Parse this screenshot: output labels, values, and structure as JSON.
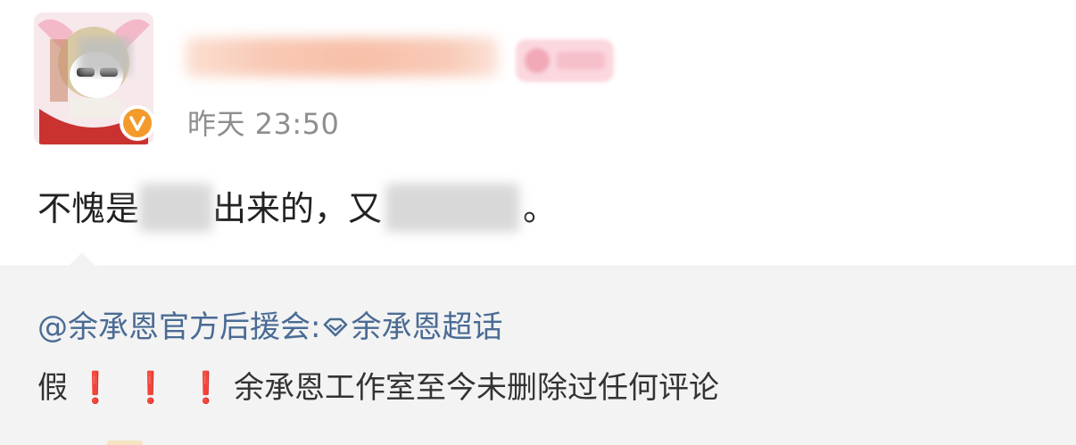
{
  "post": {
    "timestamp": "昨天 23:50",
    "text_part1": "不愧是",
    "text_part2": "出来的，又",
    "text_part3": "。"
  },
  "repost": {
    "source_mention": "@余承恩官方后援会:",
    "supertopic": "余承恩超话",
    "body_prefix": "假",
    "exclamations": [
      "❗",
      "❗",
      "❗"
    ],
    "body_text": "余承恩工作室至今未删除过任何评论"
  },
  "icons": {
    "verified": "verified-orange-v-icon",
    "supertopic": "supertopic-diamond-icon",
    "exclamation": "red-exclamation-icon"
  },
  "colors": {
    "link": "#4a6b94",
    "verified": "#f39a2b",
    "exclamation": "#e02020",
    "repost_bg": "#f3f3f3"
  }
}
